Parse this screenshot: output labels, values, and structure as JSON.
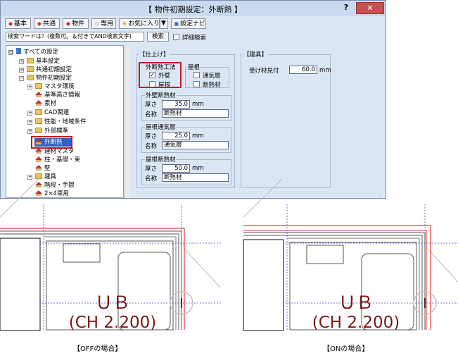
{
  "dialog": {
    "title": "【 物件初期設定：外断熱 】",
    "help": "?",
    "close": "✕"
  },
  "toolbar": {
    "basic": "基本",
    "common": "共通",
    "property": "物件",
    "dedicated": "専用",
    "favorites": "お気に入り",
    "dropdown": "▼",
    "settings_navi": "設定ナビ"
  },
  "search": {
    "placeholder": "検索ワードは？(複数可。＆付きでAND検索文字)",
    "button": "検索",
    "detail_label": "詳細検索"
  },
  "tree": {
    "items": [
      {
        "label": "すべての設定",
        "exp": "⊟"
      },
      {
        "label": "基本設定",
        "exp": "+"
      },
      {
        "label": "共通初期設定",
        "exp": "+"
      },
      {
        "label": "物件初期設定",
        "exp": "−"
      },
      {
        "label": "マスタ環境",
        "exp": "+"
      },
      {
        "label": "基準高さ情報",
        "exp": ""
      },
      {
        "label": "素材",
        "exp": ""
      },
      {
        "label": "CAD関連",
        "exp": "+"
      },
      {
        "label": "性能・地域条件",
        "exp": "+"
      },
      {
        "label": "外部標準",
        "exp": "+"
      },
      {
        "label": "外断熱",
        "exp": ""
      },
      {
        "label": "建材マスタ",
        "exp": ""
      },
      {
        "label": "柱・基礎・束",
        "exp": ""
      },
      {
        "label": "壁",
        "exp": ""
      },
      {
        "label": "建具",
        "exp": "+"
      },
      {
        "label": "階段・手摺",
        "exp": ""
      },
      {
        "label": "2×4専用",
        "exp": ""
      }
    ]
  },
  "finish": {
    "title": "【仕上げ】",
    "method_title": "外断熱工法",
    "exterior_wall": "外壁",
    "exterior_wall_checked": "✓",
    "roof": "屋根",
    "roof_group_title": "屋根",
    "roof_vent": "通気層",
    "roof_insulation": "断熱材",
    "wall_insulation": {
      "title": "外壁断熱材",
      "thickness_label": "厚さ",
      "thickness": "35.0",
      "unit": "mm",
      "name_label": "名称",
      "name": "断熱材"
    },
    "roof_vent_layer": {
      "title": "屋根通気層",
      "thickness_label": "厚さ",
      "thickness": "25.0",
      "unit": "mm",
      "name_label": "名称",
      "name": "通気層"
    },
    "roof_insulation_material": {
      "title": "屋根断熱材",
      "thickness_label": "厚さ",
      "thickness": "50.0",
      "unit": "mm",
      "name_label": "名称",
      "name": "断熱材"
    }
  },
  "fittings": {
    "title": "【建具】",
    "receiver_label": "受け材見付",
    "receiver_value": "60.0",
    "unit": "mm"
  },
  "drawings": {
    "ub_text": "ＵＢ",
    "ch_text": "(CH 2.200)",
    "caption_off": "【OFFの場合】",
    "caption_on": "【ONの場合】"
  },
  "colors": {
    "highlight": "#c8191f",
    "selection": "#3160c4",
    "wall_red": "#e04040",
    "guide_blue": "#6f6fe0",
    "text_maroon": "#7a1a1a"
  }
}
